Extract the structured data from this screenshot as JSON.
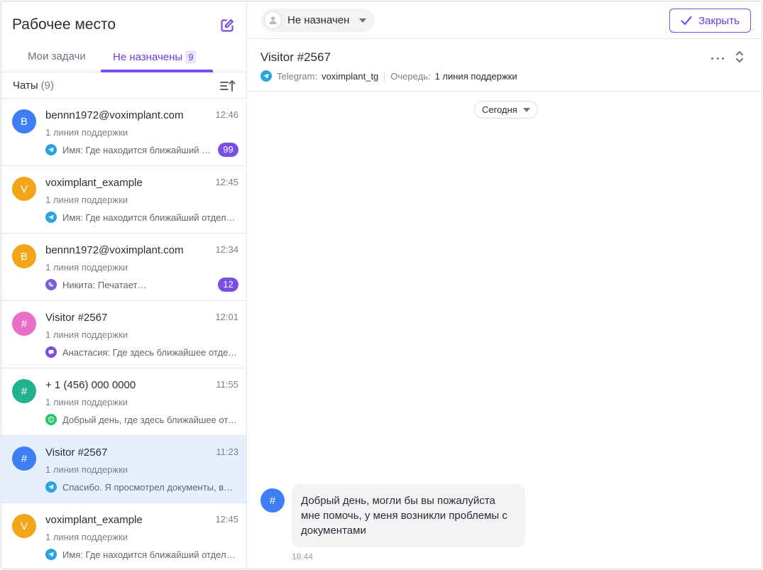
{
  "sidebar": {
    "title": "Рабочее место",
    "tabs": [
      {
        "label": "Мои задачи"
      },
      {
        "label": "Не назначены",
        "count": "9"
      }
    ],
    "chats_label": "Чаты",
    "chats_count": "(9)"
  },
  "chats": [
    {
      "initial": "B",
      "color": "#3d7ef5",
      "name": "bennn1972@voximplant.com",
      "time": "12:46",
      "queue": "1 линия поддержки",
      "channel": "telegram",
      "preview": "Имя: Где находится ближайший отдел...",
      "badge": "99"
    },
    {
      "initial": "V",
      "color": "#f2a516",
      "name": "voximplant_example",
      "time": "12:45",
      "queue": "1 линия поддержки",
      "channel": "telegram",
      "preview": "Имя: Где находится ближайший отделение"
    },
    {
      "initial": "B",
      "color": "#f2a516",
      "name": "bennn1972@voximplant.com",
      "time": "12:34",
      "queue": "1 линия поддержки",
      "channel": "viber",
      "preview": "Никита: Печатает…",
      "badge": "12"
    },
    {
      "initial": "#",
      "color": "#ea6ec8",
      "name": "Visitor #2567",
      "time": "12:01",
      "queue": "1 линия поддержки",
      "channel": "webchat",
      "preview": "Анастасия: Где здесь ближайшее отделение"
    },
    {
      "initial": "#",
      "color": "#21b28f",
      "name": "+ 1 (456) 000 0000",
      "time": "11:55",
      "queue": "1 линия поддержки",
      "channel": "whatsapp",
      "preview": "Добрый день, где здесь ближайшее отделение"
    },
    {
      "initial": "#",
      "color": "#3d7ef5",
      "name": "Visitor #2567",
      "time": "11:23",
      "queue": "1 линия поддержки",
      "channel": "telegram",
      "preview": "Спасибо. Я просмотрел документы, всё хорошо",
      "selected": true
    },
    {
      "initial": "V",
      "color": "#f2a516",
      "name": "voximplant_example",
      "time": "12:45",
      "queue": "1 линия поддержки",
      "channel": "telegram",
      "preview": "Имя: Где находится ближайший отделение"
    }
  ],
  "topbar": {
    "assignee": "Не назначен",
    "close_label": "Закрыть"
  },
  "conversation": {
    "title": "Visitor #2567",
    "channel_key": "Telegram:",
    "channel_value": "voximplant_tg",
    "queue_key": "Очередь:",
    "queue_value": "1 линия поддержки",
    "date_filter": "Сегодня"
  },
  "message": {
    "avatar": "#",
    "text": "Добрый день, могли бы вы пожалуйста мне помочь, у меня возникли проблемы с документами",
    "time": "18:44"
  },
  "colors": {
    "accent": "#7b4de8",
    "telegram": "#2aa3e0",
    "viber": "#7b5fd6",
    "webchat": "#7b4de8",
    "whatsapp": "#25c467"
  }
}
